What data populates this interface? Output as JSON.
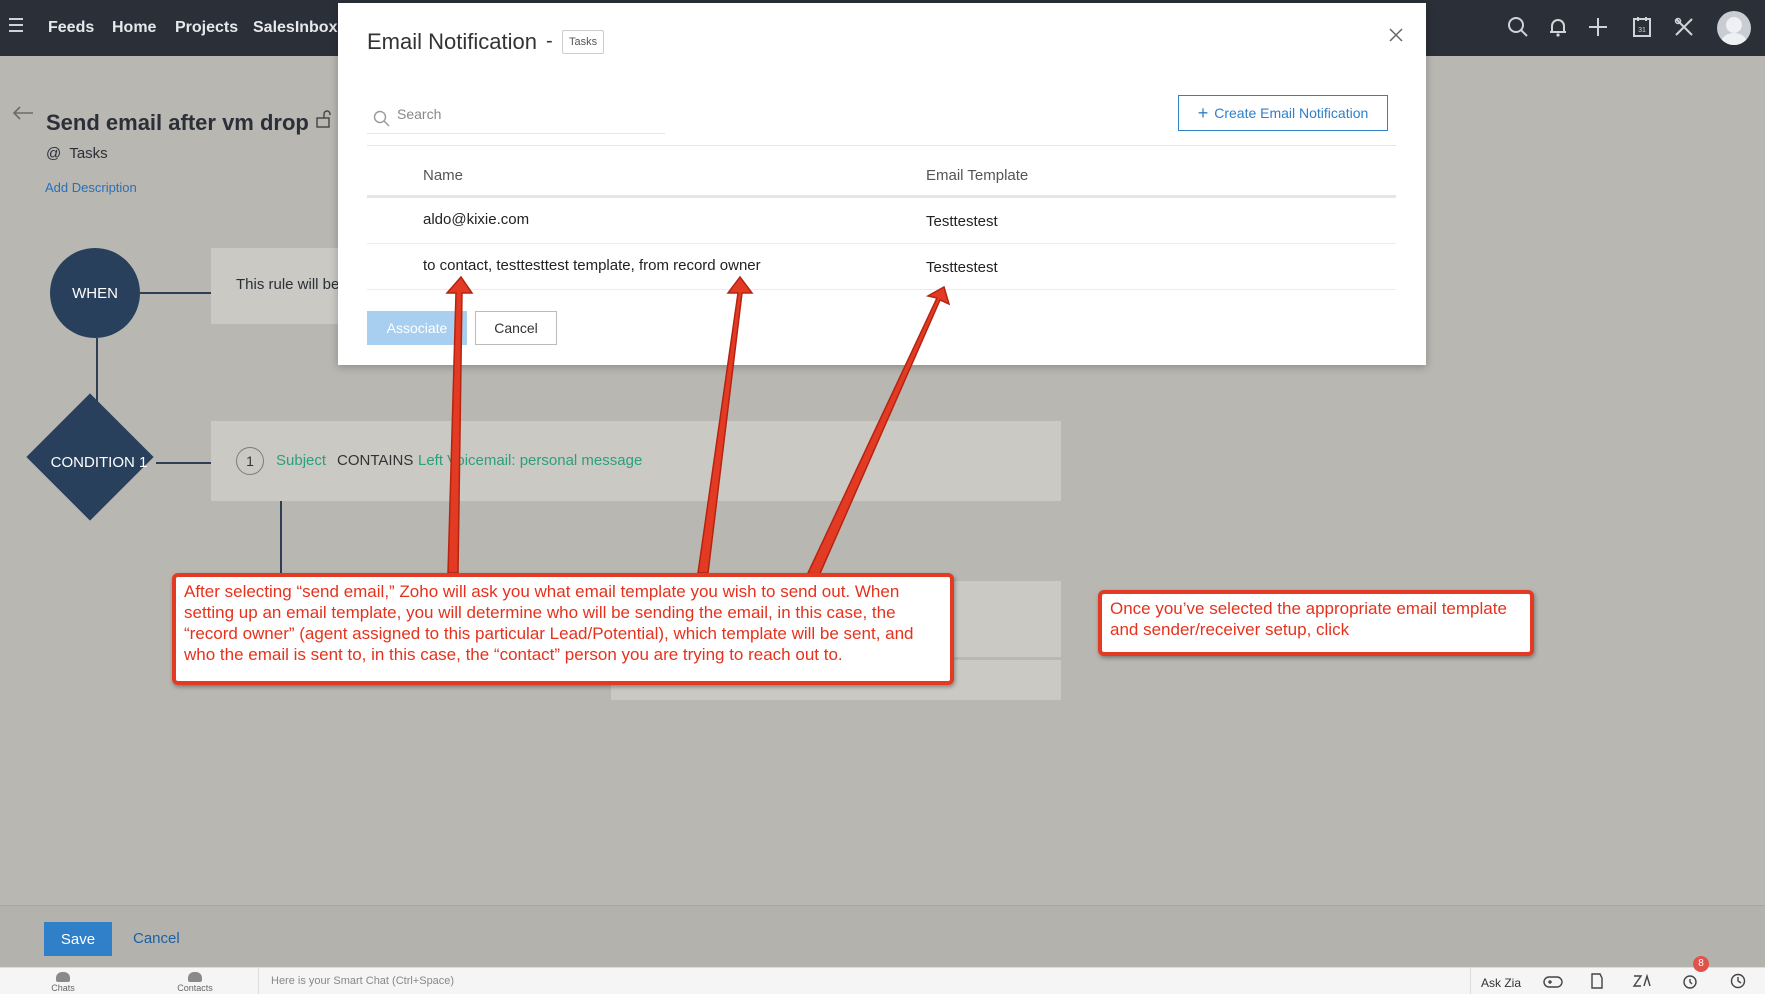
{
  "topnav": {
    "items": [
      "Feeds",
      "Home",
      "Projects",
      "SalesInbox"
    ],
    "icons": [
      "search-icon",
      "bell-icon",
      "plus-icon",
      "calendar-icon",
      "tools-icon"
    ],
    "calendar_day": "31"
  },
  "rule": {
    "title": "Send email after vm drop",
    "module_prefix": "@",
    "module": "Tasks",
    "add_description": "Add Description"
  },
  "workflow": {
    "when_label": "WHEN",
    "when_text": "This rule will be",
    "condition_label": "CONDITION 1",
    "condition": {
      "number": "1",
      "field": "Subject",
      "operator": "CONTAINS",
      "value": "Left Voicemail: personal message"
    }
  },
  "footer": {
    "save_label": "Save",
    "cancel_label": "Cancel"
  },
  "chatbar": {
    "chats_label": "Chats",
    "contacts_label": "Contacts",
    "placeholder": "Here is your Smart Chat (Ctrl+Space)",
    "ask_zia": "Ask Zia",
    "badge_count": "8"
  },
  "modal": {
    "title": "Email Notification",
    "dash": "-",
    "tag": "Tasks",
    "search_placeholder": "Search",
    "create_button": "Create Email Notification",
    "columns": [
      "Name",
      "Email Template"
    ],
    "rows": [
      {
        "name": "aldo@kixie.com",
        "template": "Testtestest"
      },
      {
        "name": "to contact, testtesttest template, from record owner",
        "template": "Testtestest"
      }
    ],
    "associate_button": "Associate",
    "cancel_button": "Cancel"
  },
  "annotations": {
    "note_left": "After selecting “send email,” Zoho will ask you what email template you wish to send out. When setting up an email template, you will determine who will be sending the email, in this case, the “record owner” (agent assigned to this particular Lead/Potential), which template will be sent, and who the email is sent to, in this case, the “contact” person you are trying to reach out to.",
    "note_right": "Once you’ve selected the appropriate email template and sender/receiver setup, click",
    "arrow_color": "#e33a24"
  }
}
